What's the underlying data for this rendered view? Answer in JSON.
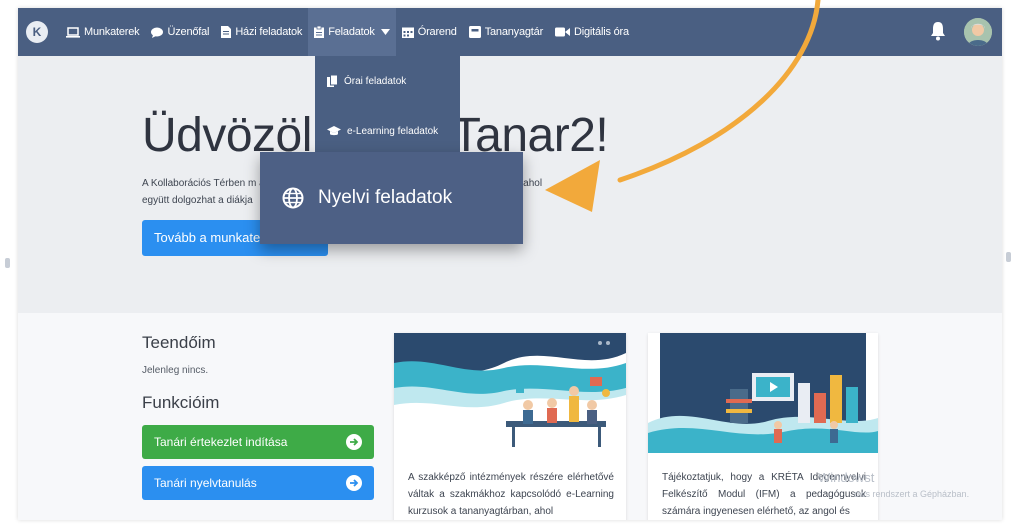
{
  "nav": {
    "logo": "K",
    "items": [
      {
        "label": "Munkaterek",
        "icon": "laptop-icon"
      },
      {
        "label": "Üzenőfal",
        "icon": "chat-bubble-icon"
      },
      {
        "label": "Házi feladatok",
        "icon": "document-icon"
      },
      {
        "label": "Feladatok",
        "icon": "clipboard-icon",
        "dropdown": true
      },
      {
        "label": "Órarend",
        "icon": "calendar-icon"
      },
      {
        "label": "Tananyagtár",
        "icon": "book-icon"
      },
      {
        "label": "Digitális óra",
        "icon": "video-camera-icon"
      }
    ],
    "bell_icon": "bell-icon",
    "avatar": "user-avatar"
  },
  "dropdown": {
    "items": [
      {
        "label": "Órai feladatok",
        "icon": "copy-document-icon"
      },
      {
        "label": "e-Learning feladatok",
        "icon": "graduation-cap-icon"
      }
    ]
  },
  "popup": {
    "label": "Nyelvi feladatok",
    "icon": "globe-icon"
  },
  "hero": {
    "title": "Üdvözöli                    opan Tanar2!",
    "text_line1": "A Kollaborációs Térben m                                             ása va          elt                  k alapján automatikusan létrehozott - területeket, ahol",
    "text_line2": "együtt dolgozhat a diákja",
    "button_label": "Tovább a munkater"
  },
  "todo": {
    "title": "Teendőim",
    "empty": "Jelenleg nincs."
  },
  "functions": {
    "title": "Funkcióim",
    "buttons": [
      {
        "label": "Tanári értekezlet indítása",
        "color": "#3eab47"
      },
      {
        "label": "Tanári nyelvtanulás",
        "color": "#2b8ff0"
      }
    ]
  },
  "cards": [
    {
      "text": "A szakképző intézmények részére elérhetővé váltak a szakmákhoz kapcsolódó e-Learning kurzusok a tananyagtárban, ahol"
    },
    {
      "text": "Tájékoztatjuk, hogy a KRÉTA Idegennyelvi Felkészítő Modul (IFM) a pedagógusok számára ingyenesen elérhető, az angol és"
    }
  ],
  "watermark": {
    "line1": "Windowst",
    "line2": "ows rendszert a Gépházban."
  },
  "colors": {
    "nav": "#4a5f82",
    "accent_blue": "#2b8ff0",
    "accent_green": "#3eab47",
    "arrow": "#f2a93b"
  }
}
